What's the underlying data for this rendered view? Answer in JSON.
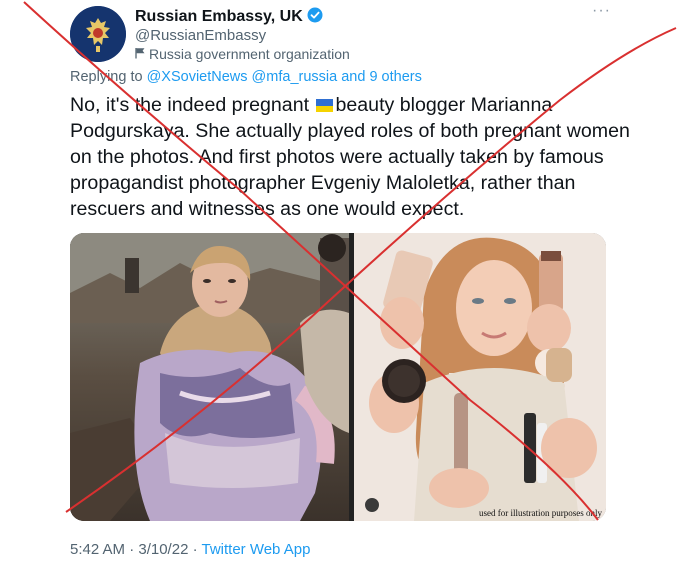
{
  "tweet": {
    "display_name": "Russian Embassy, UK",
    "handle": "@RussianEmbassy",
    "account_label": "Russia government organization",
    "more_icon": "more-options-icon",
    "reply": {
      "prefix": "Replying to ",
      "mentions": "@XSovietNews @mfa_russia",
      "suffix": " and 9 others"
    },
    "text_before_flag": "No, it's the indeed pregnant ",
    "text_after_flag": "beauty blogger Marianna Podgurskaya. She actually played roles of both pregnant women on the photos. And first photos were actually taken by famous propagandist photographer Evgeniy Maloletka, rather than rescuers and witnesses as one would expect.",
    "flag_colors": [
      "#2f6fd1",
      "#f5d300"
    ],
    "photo_note": "used for illustration purposes only",
    "time": "5:42 AM · 3/10/22 · ",
    "app": "Twitter Web App"
  },
  "overlay": {
    "cross_color": "#d93030"
  }
}
